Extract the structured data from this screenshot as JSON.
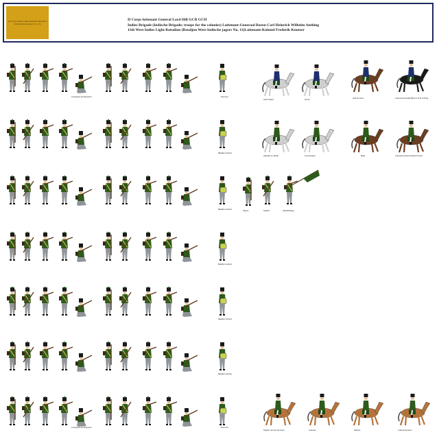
{
  "header": {
    "badge_text": "11th West Indies Light Battalion (Bataljon West-Indische jagers No. 11)",
    "line1": "II Corps luitenant General Lord Hill GCB GCH",
    "line2": "Indies Brigade (Indische Brigade; troops for the colonies) Luitenant-Generaal Baron Carl Heinrich Wilhelm Anthing",
    "line3": "11th West Indies Light Battalion (Bataljon West-Indische jagers No. 11)Luitenant-Kolonel Frederik Knotzer"
  },
  "captions": {
    "company_first": "Compagnie de flanqueurs",
    "drummer": "Drummer",
    "bugler_r1": "Hoorn-blazer",
    "hornist": "Kornet",
    "aide": "Aide-de-camp",
    "general": "Luitenant-Generaal Baron C.H.W. Anthing",
    "battalion_drummer": "Bataillon tambour",
    "adjutant": "Adjudant en officier",
    "commander": "Commandant",
    "major": "Major",
    "colonel": "Luitenant-Kolonel Frederik Knotzer",
    "sapper": "Sapeur",
    "captain": "Kapitein",
    "standard": "Vaandeldrager",
    "company_last": "Compagnie de flanqueurs",
    "drummer_last": "Drummer",
    "cav1": "Kapitein Jan van der Hoop",
    "cav2": "Luitenant",
    "cav3": "Kapitein",
    "cav4": "Luitenant-Kolonel"
  },
  "colors": {
    "frame": "#1d2a5c",
    "badge": "#d4a017",
    "jacket": "#2e5a1c",
    "trousers": "#8f9499",
    "belt": "#e8d35a",
    "shako": "#1a1a1a",
    "horse_grey": "#cfcfcf",
    "horse_brown": "#6b3e22",
    "horse_chestnut": "#b5733a",
    "general_coat": "#1e2f6b"
  }
}
